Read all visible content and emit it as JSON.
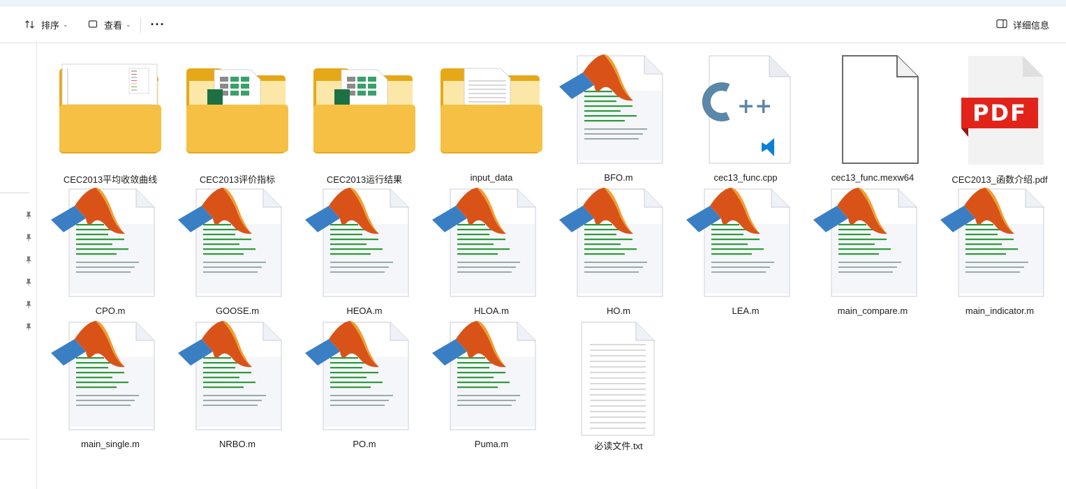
{
  "toolbar": {
    "sort_label": "排序",
    "view_label": "查看",
    "more_label": "···",
    "details_label": "详细信息"
  },
  "icons": {
    "sort": "sort-arrows-icon",
    "view": "view-layout-icon",
    "details": "details-pane-icon",
    "pin": "pin-icon",
    "folder": "folder-icon",
    "matlab": "matlab-file-icon",
    "cpp": "cpp-file-icon",
    "blank": "blank-file-icon",
    "pdf": "pdf-file-icon",
    "txt": "text-file-icon"
  },
  "colors": {
    "folder": "#f5c043",
    "folder_dark": "#e6a817",
    "matlab_orange": "#d95319",
    "matlab_blue": "#3a7fc4",
    "pdf_red": "#e2231a",
    "cpp_teal": "#5b87a8",
    "vscode_blue": "#0e7fd6"
  },
  "files": [
    {
      "name": "CEC2013平均收敛曲线",
      "type": "folder",
      "preview": "chart"
    },
    {
      "name": "CEC2013评价指标",
      "type": "folder",
      "preview": "excel"
    },
    {
      "name": "CEC2013运行结果",
      "type": "folder",
      "preview": "excel"
    },
    {
      "name": "input_data",
      "type": "folder",
      "preview": "doc"
    },
    {
      "name": "BFO.m",
      "type": "matlab"
    },
    {
      "name": "cec13_func.cpp",
      "type": "cpp"
    },
    {
      "name": "cec13_func.mexw64",
      "type": "blank"
    },
    {
      "name": "CEC2013_函数介绍.pdf",
      "type": "pdf",
      "badge": "PDF"
    },
    {
      "name": "CPO.m",
      "type": "matlab"
    },
    {
      "name": "GOOSE.m",
      "type": "matlab"
    },
    {
      "name": "HEOA.m",
      "type": "matlab"
    },
    {
      "name": "HLOA.m",
      "type": "matlab"
    },
    {
      "name": "HO.m",
      "type": "matlab"
    },
    {
      "name": "LEA.m",
      "type": "matlab"
    },
    {
      "name": "main_compare.m",
      "type": "matlab"
    },
    {
      "name": "main_indicator.m",
      "type": "matlab"
    },
    {
      "name": "main_single.m",
      "type": "matlab"
    },
    {
      "name": "NRBO.m",
      "type": "matlab"
    },
    {
      "name": "PO.m",
      "type": "matlab"
    },
    {
      "name": "Puma.m",
      "type": "matlab"
    },
    {
      "name": "必读文件.txt",
      "type": "txt"
    }
  ]
}
